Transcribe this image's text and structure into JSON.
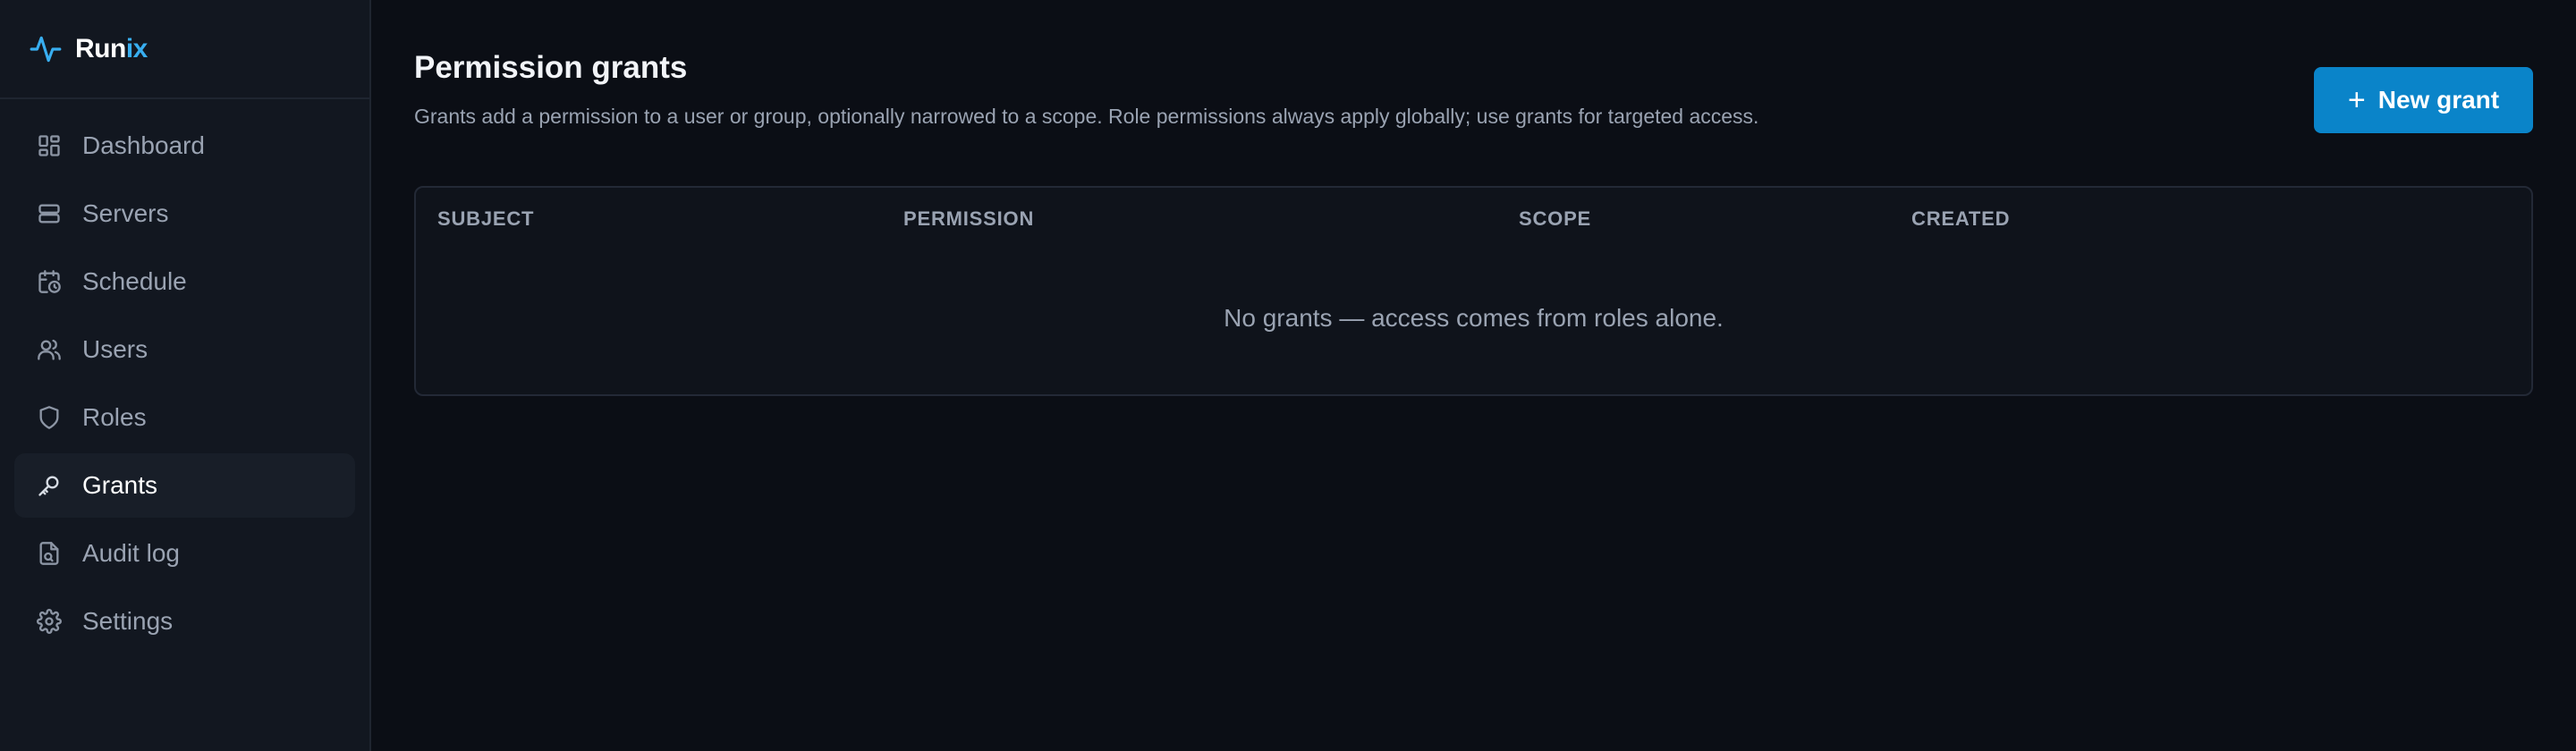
{
  "brand": {
    "name_part1": "Run",
    "name_part2": "ix",
    "icon": "activity-pulse-icon",
    "accent_color": "#38aef0"
  },
  "sidebar": {
    "items": [
      {
        "label": "Dashboard",
        "icon": "dashboard-icon",
        "active": false
      },
      {
        "label": "Servers",
        "icon": "server-icon",
        "active": false
      },
      {
        "label": "Schedule",
        "icon": "calendar-clock-icon",
        "active": false
      },
      {
        "label": "Users",
        "icon": "users-icon",
        "active": false
      },
      {
        "label": "Roles",
        "icon": "shield-icon",
        "active": false
      },
      {
        "label": "Grants",
        "icon": "key-icon",
        "active": true
      },
      {
        "label": "Audit log",
        "icon": "file-search-icon",
        "active": false
      },
      {
        "label": "Settings",
        "icon": "gear-icon",
        "active": false
      }
    ]
  },
  "header": {
    "title": "Permission grants",
    "description": "Grants add a permission to a user or group, optionally narrowed to a scope. Role permissions always apply globally; use grants for targeted access.",
    "new_button_label": "New grant",
    "button_color": "#0a84c9"
  },
  "table": {
    "columns": [
      "SUBJECT",
      "PERMISSION",
      "SCOPE",
      "CREATED"
    ],
    "rows": [],
    "empty_message": "No grants — access comes from roles alone."
  }
}
